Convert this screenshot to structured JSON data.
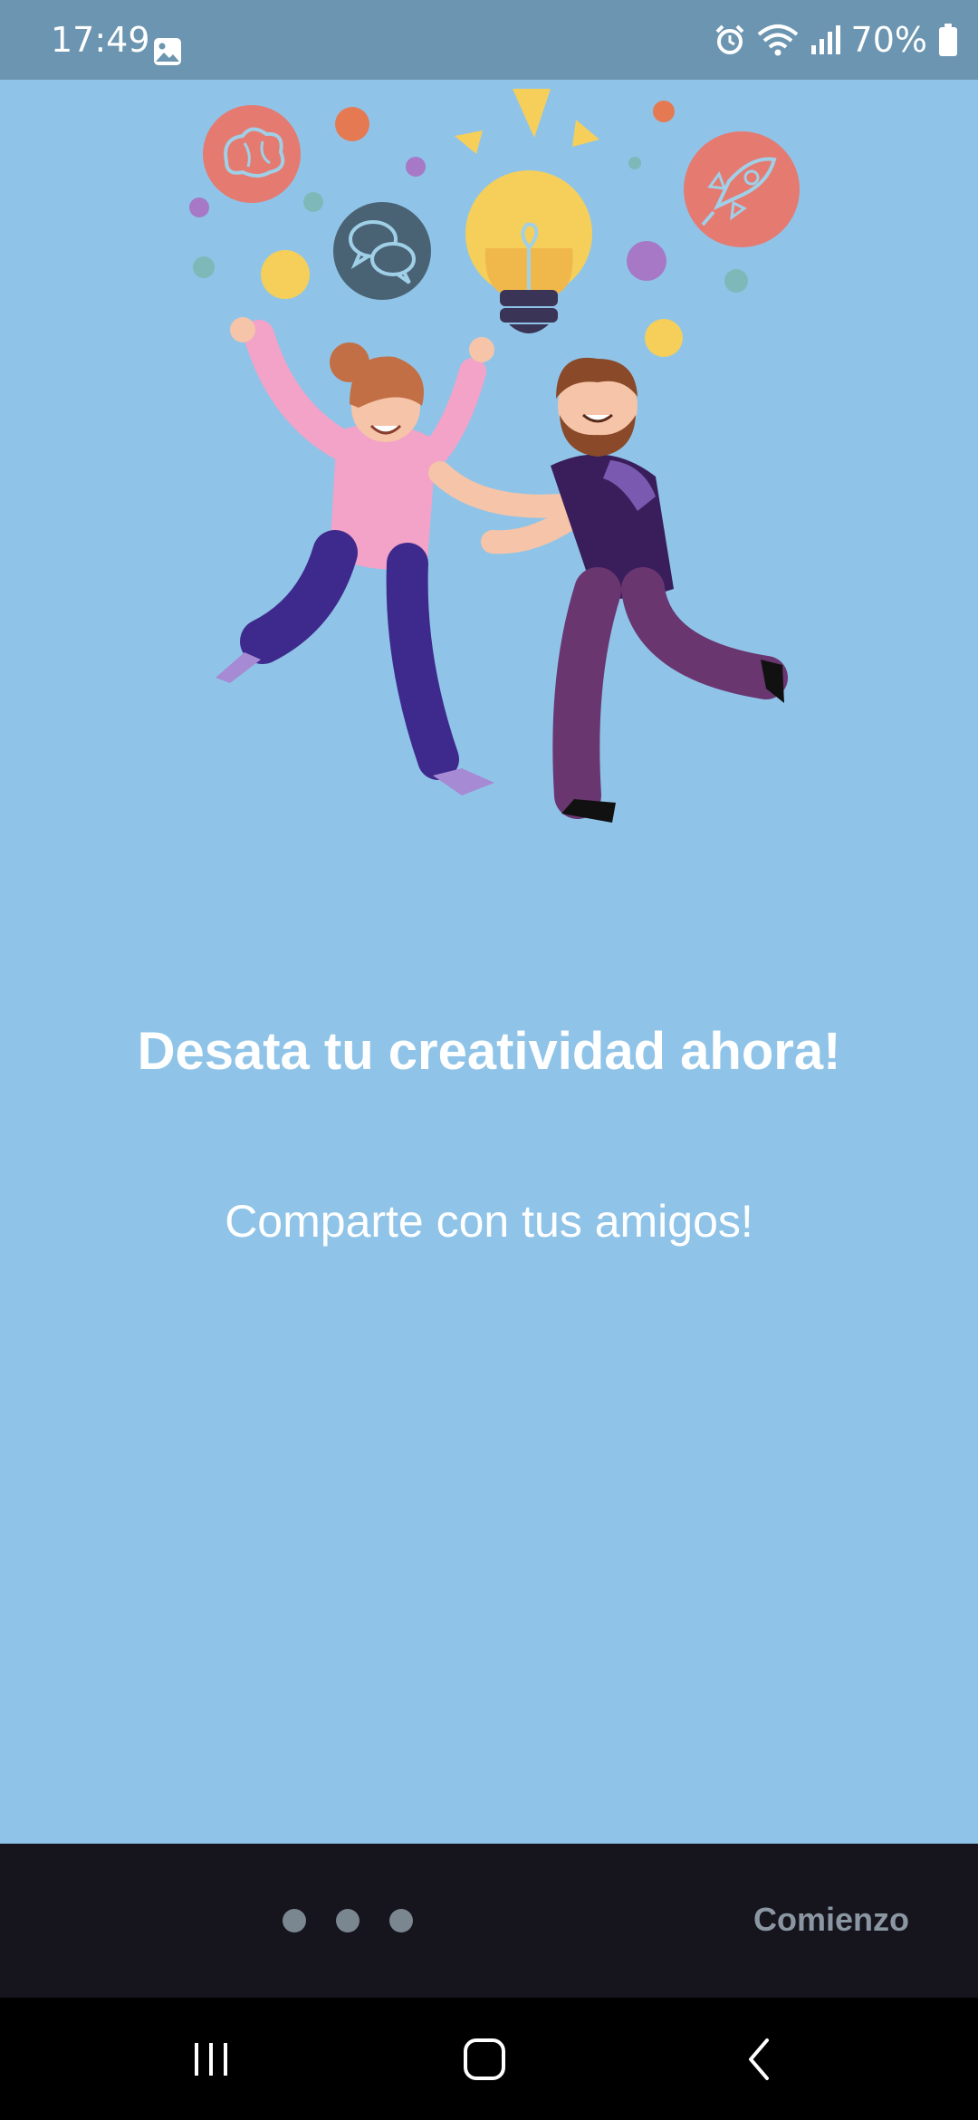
{
  "status_bar": {
    "time": "17:49",
    "battery": "70%",
    "icons": [
      "gallery-icon",
      "alarm-icon",
      "wifi-icon",
      "signal-icon",
      "battery-icon"
    ],
    "background_color": "#6b95b0"
  },
  "onboarding": {
    "headline": "Desata tu creatividad ahora!",
    "subline": "Comparte con tus amigos!",
    "illustration": "two-people-jumping-lightbulb-illustration",
    "background_color": "#8fc4e8"
  },
  "bottom_bar": {
    "page_indicator": {
      "count": 3
    },
    "start_label": "Comienzo",
    "background_color": "#16141c"
  },
  "navigation_bar": {
    "buttons": [
      "recents-icon",
      "home-icon",
      "back-icon"
    ]
  }
}
